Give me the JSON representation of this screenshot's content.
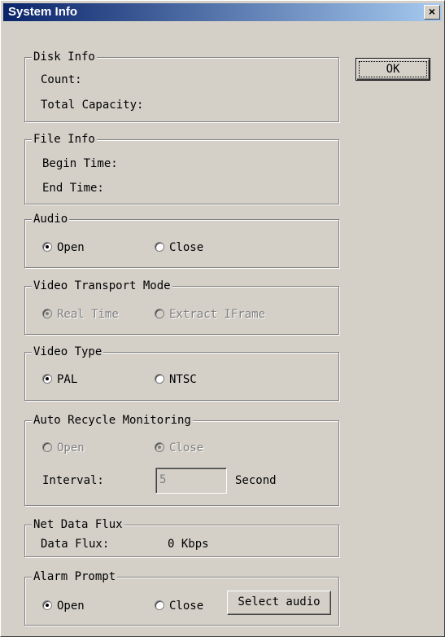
{
  "window": {
    "title": "System Info",
    "close_label": "×"
  },
  "ok_button": {
    "label": "OK"
  },
  "disk_info": {
    "legend": "Disk Info",
    "count_label": "Count:",
    "capacity_label": "Total Capacity:"
  },
  "file_info": {
    "legend": "File Info",
    "begin_label": "Begin Time:",
    "end_label": "End Time:"
  },
  "audio": {
    "legend": "Audio",
    "options": [
      "Open",
      "Close"
    ],
    "selected": "Open"
  },
  "video_transport": {
    "legend": "Video Transport Mode",
    "options": [
      "Real Time",
      "Extract IFrame"
    ],
    "selected": "Real Time",
    "disabled": true
  },
  "video_type": {
    "legend": "Video Type",
    "options": [
      "PAL",
      "NTSC"
    ],
    "selected": "PAL"
  },
  "auto_recycle": {
    "legend": "Auto Recycle Monitoring",
    "options": [
      "Open",
      "Close"
    ],
    "selected": "Close",
    "disabled": true,
    "interval_label": "Interval:",
    "interval_value": "5",
    "interval_unit": "Second"
  },
  "net_flux": {
    "legend": "Net Data Flux",
    "label": "Data Flux:",
    "value": "0 Kbps"
  },
  "alarm": {
    "legend": "Alarm Prompt",
    "options": [
      "Open",
      "Close"
    ],
    "selected": "Open",
    "select_audio_label": "Select audio"
  }
}
